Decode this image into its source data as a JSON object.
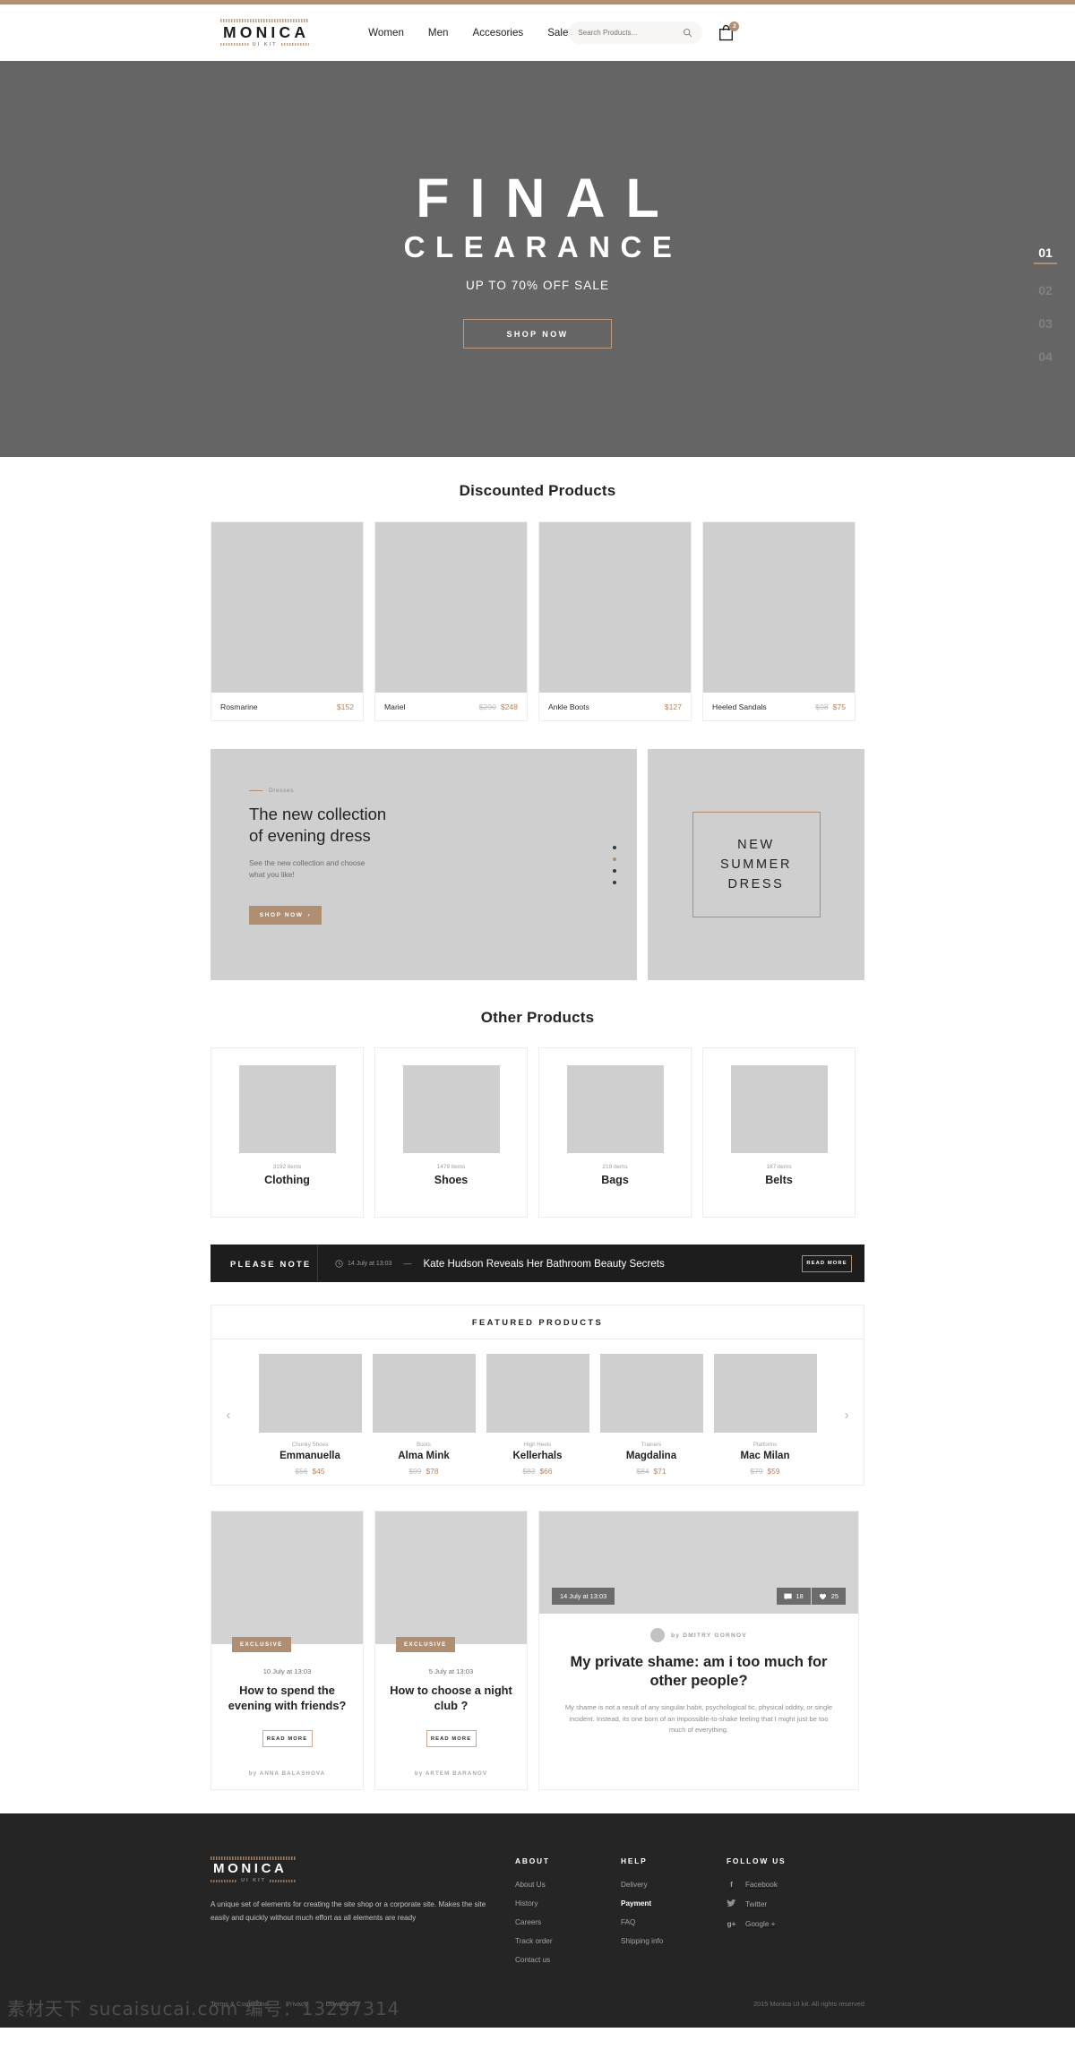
{
  "brand": {
    "word": "MONICA",
    "kit": "UI KIT"
  },
  "header": {
    "nav": [
      {
        "label": "Women"
      },
      {
        "label": "Men"
      },
      {
        "label": "Accesories"
      },
      {
        "label": "Sale"
      }
    ],
    "search_placeholder": "Search Products...",
    "cart_count": "2"
  },
  "hero": {
    "title": "FINAL",
    "subtitle": "CLEARANCE",
    "tagline": "UP TO 70% OFF SALE",
    "button": "SHOP NOW",
    "slides": [
      "01",
      "02",
      "03",
      "04"
    ],
    "active_slide": "01",
    "bg_color": "#656565",
    "accent": "#b08e72"
  },
  "discounted": {
    "title": "Discounted Products",
    "products": [
      {
        "name": "Rosmarine",
        "old": "",
        "new": "$152"
      },
      {
        "name": "Mariel",
        "old": "$290",
        "new": "$248"
      },
      {
        "name": "Ankle Boots",
        "old": "",
        "new": "$127"
      },
      {
        "name": "Heeled Sandals",
        "old": "$98",
        "new": "$75"
      }
    ]
  },
  "promo": {
    "kicker": "Dresses",
    "heading_line1": "The new collection",
    "heading_line2": "of evening dress",
    "text_line1": "See the new collection and choose",
    "text_line2": "what you like!",
    "button": "SHOP NOW",
    "button_arrow": "›",
    "dots_active_index": 1,
    "side_line1": "NEW",
    "side_line2": "SUMMER",
    "side_line3": "DRESS"
  },
  "categories": {
    "title": "Other Products",
    "items": [
      {
        "count": "3192 items",
        "name": "Clothing"
      },
      {
        "count": "1479 items",
        "name": "Shoes"
      },
      {
        "count": "219 items",
        "name": "Bags"
      },
      {
        "count": "187 items",
        "name": "Belts"
      }
    ]
  },
  "note": {
    "label": "PLEASE NOTE",
    "time": "14 July at 13:03",
    "dash": "—",
    "headline": "Kate Hudson Reveals Her Bathroom Beauty Secrets",
    "button": "READ MORE"
  },
  "featured": {
    "title": "FEATURED PRODUCTS",
    "prev": "‹",
    "next": "›",
    "items": [
      {
        "category": "Chunky Shoes",
        "name": "Emmanuella",
        "old": "$56",
        "new": "$45"
      },
      {
        "category": "Boots",
        "name": "Alma Mink",
        "old": "$99",
        "new": "$78"
      },
      {
        "category": "High Heels",
        "name": "Kellerhals",
        "old": "$83",
        "new": "$66"
      },
      {
        "category": "Trainers",
        "name": "Magdalina",
        "old": "$84",
        "new": "$71"
      },
      {
        "category": "Platforms",
        "name": "Mac Milan",
        "old": "$79",
        "new": "$59"
      }
    ]
  },
  "blog": {
    "cards": [
      {
        "badge": "EXCLUSIVE",
        "date": "10 July at 13:03",
        "title": "How to spend the evening with friends?",
        "button": "READ MORE",
        "author": "by ANNA BALASHOVA"
      },
      {
        "badge": "EXCLUSIVE",
        "date": "5 July at 13:03",
        "title": "How to choose a night club ?",
        "button": "READ MORE",
        "author": "by ARTEM BARANOV"
      }
    ],
    "feature": {
      "date": "14 July at 13:03",
      "comments": "18",
      "likes": "25",
      "author": "by DMITRY GORNOV",
      "title": "My private shame: am i too much for other people?",
      "excerpt": "My shame is not a result of any singular habit, psychological tic, physical oddity, or single incident. Instead, its one born of an impossible-to-shake feeling that I might just be too much of everything."
    }
  },
  "footer": {
    "description": "A unique set of elements for creating the site shop or a corporate site. Makes the site easily and quickly without much effort as all elements are ready",
    "columns": [
      {
        "heading": "ABOUT",
        "links": [
          {
            "label": "About Us",
            "bold": false
          },
          {
            "label": "History",
            "bold": false
          },
          {
            "label": "Careers",
            "bold": false
          },
          {
            "label": "Track order",
            "bold": false
          },
          {
            "label": "Contact us",
            "bold": false
          }
        ]
      },
      {
        "heading": "HELP",
        "links": [
          {
            "label": "Delivery",
            "bold": false
          },
          {
            "label": "Payment",
            "bold": true
          },
          {
            "label": "FAQ",
            "bold": false
          },
          {
            "label": "Shipping info",
            "bold": false
          }
        ]
      }
    ],
    "follow": {
      "heading": "FOLLOW US",
      "links": [
        {
          "label": "Facebook",
          "icon": "f"
        },
        {
          "label": "Twitter",
          "icon": "t"
        },
        {
          "label": "Google +",
          "icon": "g"
        }
      ]
    },
    "bottom_links": [
      {
        "label": "Terms & Conditions"
      },
      {
        "label": "Privacy"
      },
      {
        "label": "Downloads"
      }
    ],
    "copyright": "2015 Monica UI kit. All rights reserved"
  },
  "watermark": "素材天下 sucaisucai.com  编号：13297314"
}
